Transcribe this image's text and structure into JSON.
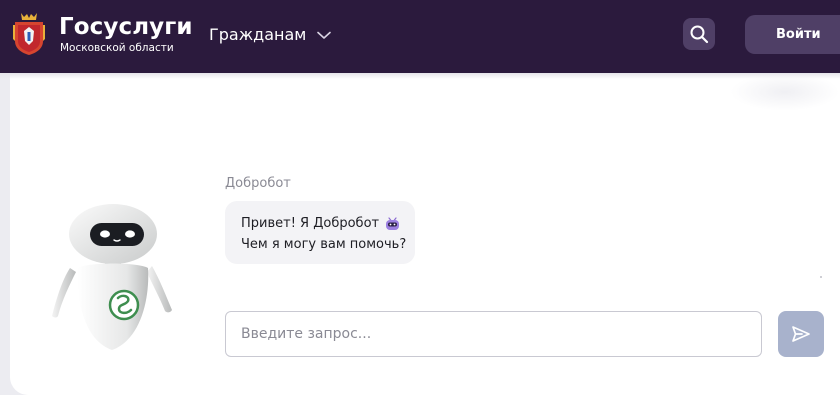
{
  "header": {
    "brand_title": "Госуслуги",
    "brand_subtitle": "Московской области",
    "nav_citizens": "Гражданам",
    "login_label": "Войти",
    "colors": {
      "background": "#2b1a3d",
      "button": "#4f3f66"
    }
  },
  "chat": {
    "bot_name": "Добробот",
    "message_line1": "Привет! Я Добробот",
    "message_line2": "Чем я могу вам помочь?",
    "input_placeholder": "Введите запрос...",
    "input_value": ""
  },
  "icons": {
    "emblem": "moscow-region-coat-of-arms-icon",
    "chevron": "chevron-down-icon",
    "search": "search-icon",
    "send": "send-icon",
    "emoji": "robot-emoji-icon"
  }
}
